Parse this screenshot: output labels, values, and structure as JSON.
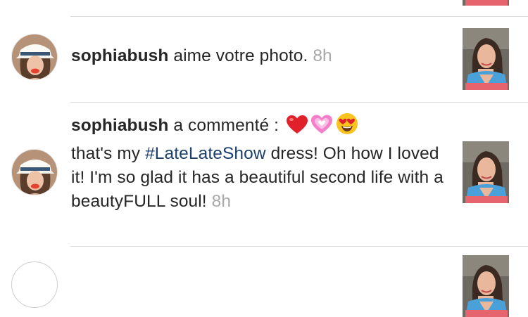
{
  "notifications": [
    {
      "username": "sophiabush",
      "action": " aime votre photo.",
      "time": "8h"
    },
    {
      "username": "sophiabush",
      "action": " a commenté : ",
      "emojis": [
        "red-heart",
        "sparkling-heart",
        "heart-eyes-face"
      ],
      "comment_before": "that's my ",
      "hashtag": "#LateLateShow",
      "comment_after": " dress! Oh how I loved it! I'm so glad it has a beautiful second life with a beautyFULL soul! ",
      "time": "8h"
    }
  ],
  "colors": {
    "separator": "#dbdbdb",
    "timestamp": "#a8a8a8",
    "hashtag": "#1c3f6e",
    "text": "#262626"
  }
}
